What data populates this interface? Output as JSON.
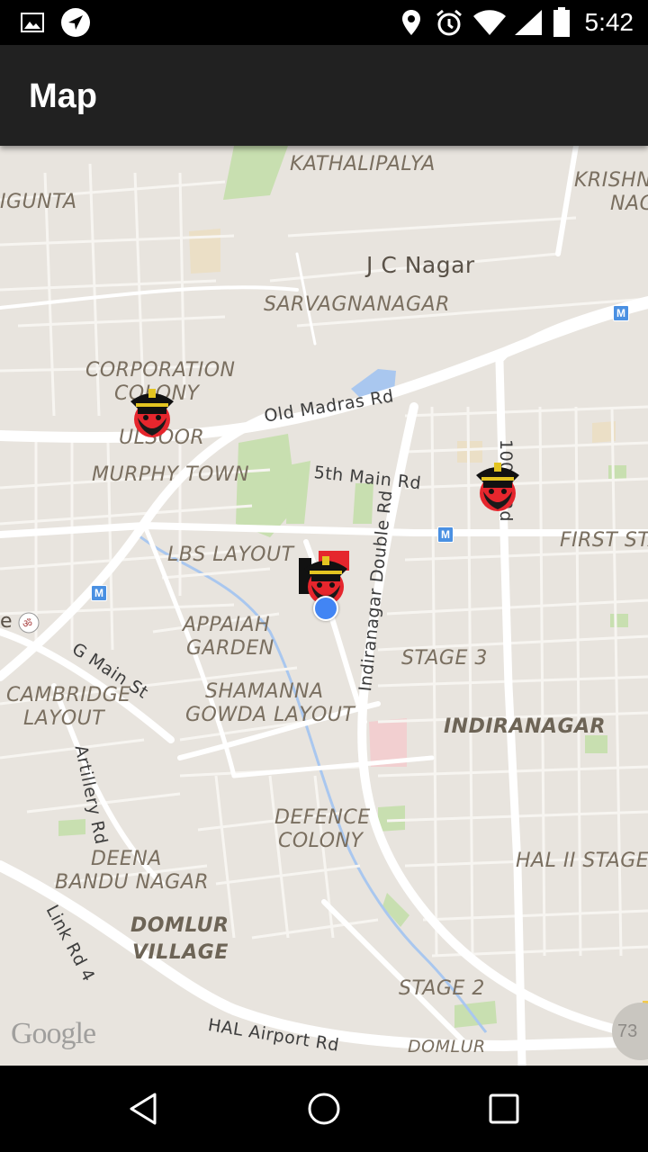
{
  "status_bar": {
    "time": "5:42",
    "icons": [
      "image-icon",
      "navigation-icon",
      "location-icon",
      "alarm-icon",
      "wifi-icon",
      "signal-icon",
      "battery-icon"
    ]
  },
  "app_bar": {
    "title": "Map"
  },
  "map": {
    "labels": {
      "kathalipalya": "KATHALIPALYA",
      "krishna": "KRISHNA",
      "nag": "NAG",
      "igunta": "IGUNTA",
      "jc_nagar": "J C Nagar",
      "sarvagnanagar": "SARVAGNANAGAR",
      "corporation": "CORPORATION",
      "colony": "COLONY",
      "old_madras_rd": "Old Madras Rd",
      "ulsoor": "ULSOOR",
      "murphy_town": "MURPHY TOWN",
      "fifth_main_rd": "5th Main Rd",
      "hundredft_rd": "100 ft Rd",
      "first_stage": "FIRST STA",
      "lbs_layout": "LBS LAYOUT",
      "indiranagar_double_rd": "Indiranagar Double Rd",
      "appaiah": "APPAIAH",
      "garden": "GARDEN",
      "g_main_st": "G Main St",
      "stage_3": "STAGE 3",
      "cambridge": "CAMBRIDGE",
      "layout": "LAYOUT",
      "shamanna": "SHAMANNA",
      "gowda_layout": "GOWDA LAYOUT",
      "indiranagar": "INDIRANAGAR",
      "artillery_rd": "Artillery Rd",
      "defence": "DEFENCE",
      "defence_colony": "COLONY",
      "deena": "DEENA",
      "bandu_nagar": "BANDU NAGAR",
      "hal_ii_stage": "HAL II STAGE",
      "link_rd_4": "Link Rd 4",
      "domlur": "DOMLUR",
      "village": "VILLAGE",
      "stage_2": "STAGE 2",
      "hal_airport_rd": "HAL Airport Rd",
      "domlur_bottom": "DOMLUR",
      "e": "e",
      "google": "Google",
      "zoom_badge": "73"
    },
    "markers": [
      {
        "name": "police-marker-ulsoor",
        "icon": "police-officer-icon"
      },
      {
        "name": "police-marker-100ft-rd",
        "icon": "police-officer-icon"
      },
      {
        "name": "police-marker-current",
        "icon": "police-officer-icon"
      }
    ]
  },
  "nav_bar": {
    "buttons": [
      "back-icon",
      "home-icon",
      "recents-icon"
    ]
  },
  "colors": {
    "app_bar": "#212121",
    "map_land": "#e8e4de",
    "road": "#ffffff",
    "park": "#c8dfb0",
    "water": "#a9c7ef",
    "my_location": "#4285f4"
  }
}
